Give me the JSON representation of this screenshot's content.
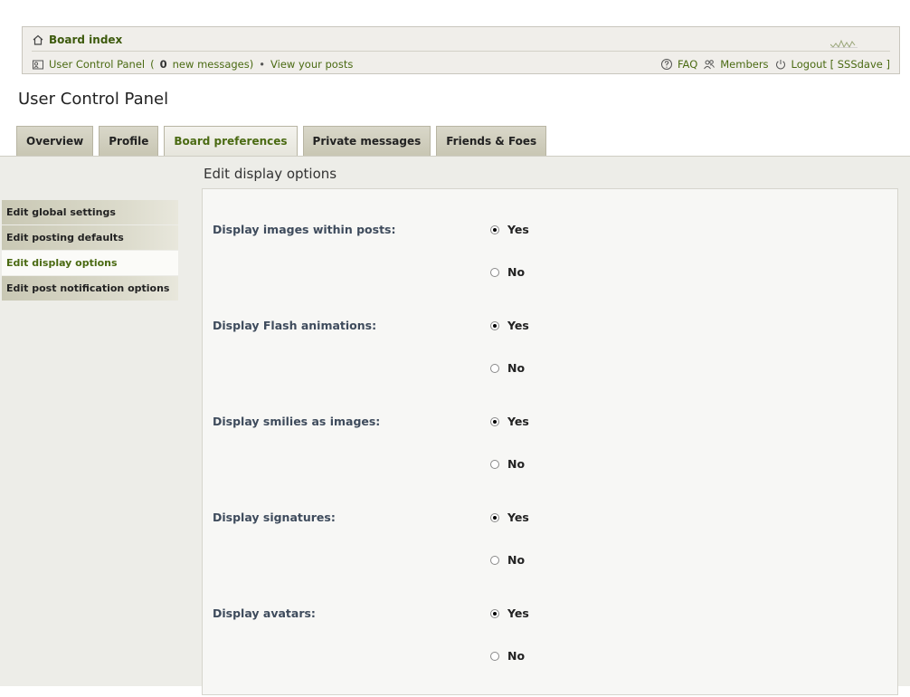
{
  "navbar": {
    "board_index": "Board index",
    "ucp_link": "User Control Panel",
    "paren_open": "(",
    "new_count": "0",
    "new_messages_text": "new messages)",
    "bullet": "•",
    "view_posts": "View your posts",
    "faq": "FAQ",
    "members": "Members",
    "logout": "Logout [ SSSdave ]",
    "icons": {
      "home": "home-icon",
      "ucp": "user-card-icon",
      "faq": "help-icon",
      "members": "members-icon",
      "logout": "power-icon",
      "font_resize": "font-resize-icon"
    }
  },
  "page_title": "User Control Panel",
  "tabs": [
    {
      "label": "Overview",
      "active": false
    },
    {
      "label": "Profile",
      "active": false
    },
    {
      "label": "Board preferences",
      "active": true
    },
    {
      "label": "Private messages",
      "active": false
    },
    {
      "label": "Friends & Foes",
      "active": false
    }
  ],
  "section_title": "Edit display options",
  "side_menu": [
    {
      "label": "Edit global settings",
      "active": false
    },
    {
      "label": "Edit posting defaults",
      "active": false
    },
    {
      "label": "Edit display options",
      "active": true
    },
    {
      "label": "Edit post notification options",
      "active": false
    }
  ],
  "options": [
    {
      "label": "Display images within posts:",
      "yes": "Yes",
      "no": "No",
      "selected": "yes"
    },
    {
      "label": "Display Flash animations:",
      "yes": "Yes",
      "no": "No",
      "selected": "yes"
    },
    {
      "label": "Display smilies as images:",
      "yes": "Yes",
      "no": "No",
      "selected": "yes"
    },
    {
      "label": "Display signatures:",
      "yes": "Yes",
      "no": "No",
      "selected": "yes"
    },
    {
      "label": "Display avatars:",
      "yes": "Yes",
      "no": "No",
      "selected": "yes"
    }
  ],
  "colors": {
    "link_green": "#4a6a12",
    "label_slate": "#3e4b5c",
    "tab_bg": "#cfcdbd",
    "panel_bg": "#edede8"
  }
}
